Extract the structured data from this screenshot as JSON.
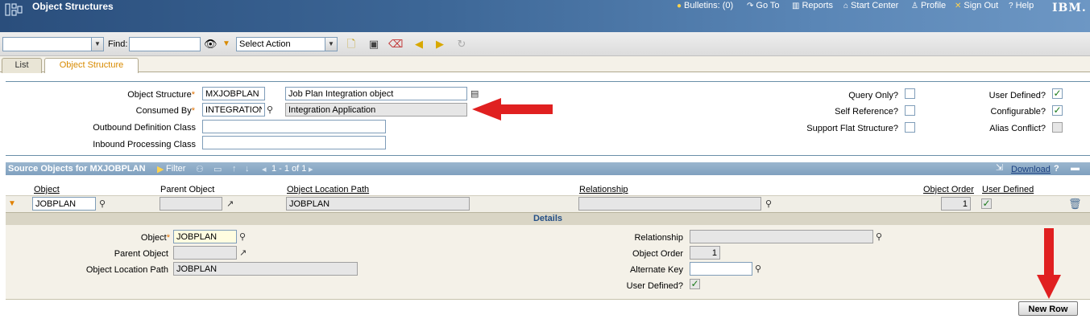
{
  "header": {
    "app_title": "Object Structures",
    "bulletins": "Bulletins: (0)",
    "goto": "Go To",
    "reports": "Reports",
    "start_center": "Start Center",
    "profile": "Profile",
    "sign_out": "Sign Out",
    "help": "Help",
    "logo": "IBM."
  },
  "toolbar": {
    "find_label": "Find:",
    "find_value": "",
    "action_select": "Select Action"
  },
  "tabs": [
    {
      "label": "List"
    },
    {
      "label": "Object Structure"
    }
  ],
  "form": {
    "object_structure_label": "Object Structure",
    "object_structure_value": "MXJOBPLAN",
    "object_structure_desc": "Job Plan Integration object",
    "consumed_by_label": "Consumed By",
    "consumed_by_value": "INTEGRATION",
    "consumed_by_desc": "Integration Application",
    "outbound_label": "Outbound Definition Class",
    "outbound_value": "",
    "inbound_label": "Inbound Processing Class",
    "inbound_value": "",
    "query_only_label": "Query Only?",
    "self_reference_label": "Self Reference?",
    "flat_structure_label": "Support Flat Structure?",
    "user_defined_label": "User Defined?",
    "configurable_label": "Configurable?",
    "alias_conflict_label": "Alias Conflict?",
    "checkmark": "✓"
  },
  "source_table": {
    "title": "Source Objects for MXJOBPLAN",
    "filter": "Filter",
    "pager": "1 - 1 of 1",
    "download": "Download",
    "help": "?",
    "columns": [
      "Object",
      "Parent Object",
      "Object Location Path",
      "Relationship",
      "Object Order",
      "User Defined"
    ],
    "row": {
      "object": "JOBPLAN",
      "parent_object": "",
      "location_path": "JOBPLAN",
      "relationship": "",
      "order": "1"
    },
    "details_title": "Details"
  },
  "details": {
    "object_label": "Object",
    "object_value": "JOBPLAN",
    "parent_label": "Parent Object",
    "parent_value": "",
    "path_label": "Object Location Path",
    "path_value": "JOBPLAN",
    "relationship_label": "Relationship",
    "relationship_value": "",
    "order_label": "Object Order",
    "order_value": "1",
    "alt_key_label": "Alternate Key",
    "alt_key_value": "",
    "user_defined_label": "User Defined?"
  },
  "buttons": {
    "new_row": "New Row"
  },
  "colors": {
    "title_bar": "#3d6797",
    "accent_orange": "#d88a00",
    "section_header": "#7fa0bf",
    "annotation_red": "#e02020"
  }
}
